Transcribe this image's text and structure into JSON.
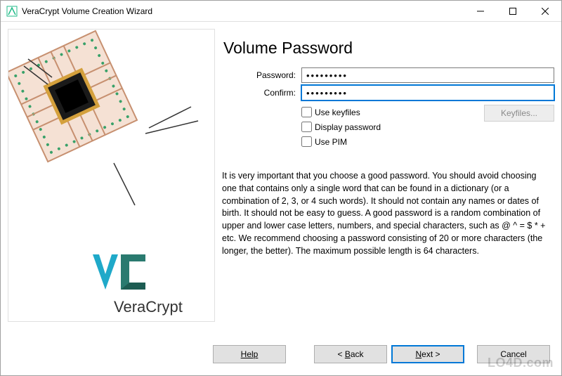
{
  "window": {
    "title": "VeraCrypt Volume Creation Wizard"
  },
  "heading": "Volume Password",
  "form": {
    "password_label": "Password:",
    "confirm_label": "Confirm:",
    "password_value": "•••••••••",
    "confirm_value": "•••••••••"
  },
  "options": {
    "use_keyfiles": "Use keyfiles",
    "display_password": "Display password",
    "use_pim": "Use PIM",
    "keyfiles_button": "Keyfiles..."
  },
  "description": "It is very important that you choose a good password. You should avoid choosing one that contains only a single word that can be found in a dictionary (or a combination of 2, 3, or 4 such words). It should not contain any names or dates of birth. It should not be easy to guess. A good password is a random combination of upper and lower case letters, numbers, and special characters, such as @ ^ = $ * + etc. We recommend choosing a password consisting of 20 or more characters (the longer, the better). The maximum possible length is 64 characters.",
  "buttons": {
    "help": "Help",
    "back": "< Back",
    "next": "Next >",
    "cancel": "Cancel"
  },
  "sidebar": {
    "brand": "VeraCrypt"
  },
  "watermark": "LO4D.com"
}
